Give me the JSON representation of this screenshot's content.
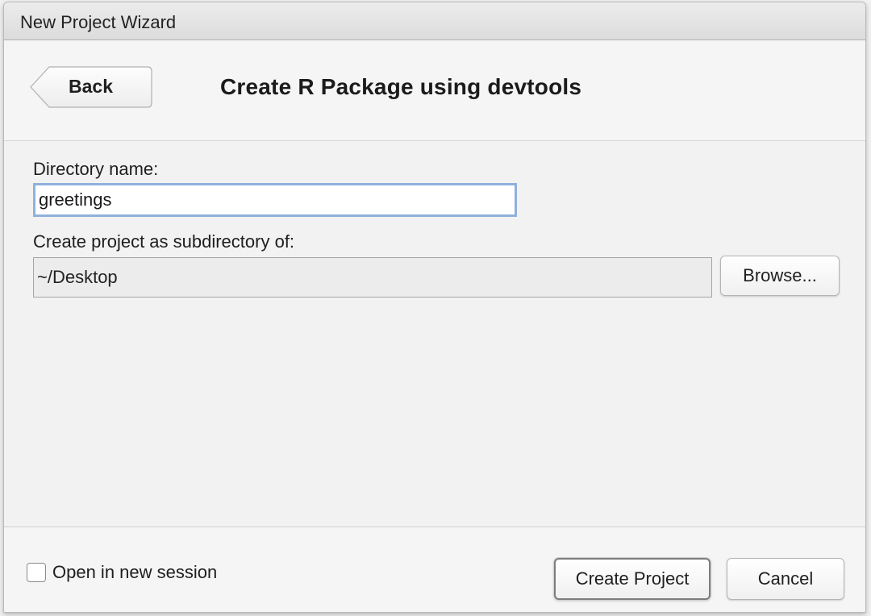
{
  "window": {
    "title": "New Project Wizard"
  },
  "header": {
    "back_label": "Back",
    "title": "Create R Package using devtools"
  },
  "form": {
    "directory_label": "Directory name:",
    "directory_value": "greetings",
    "parent_label": "Create project as subdirectory of:",
    "parent_value": "~/Desktop",
    "browse_label": "Browse..."
  },
  "footer": {
    "new_session_label": "Open in new session",
    "new_session_checked": false,
    "create_label": "Create Project",
    "cancel_label": "Cancel"
  },
  "colors": {
    "focus_border": "#8fb1dd",
    "window_bg": "#f5f5f5",
    "text": "#1f1f1f"
  }
}
